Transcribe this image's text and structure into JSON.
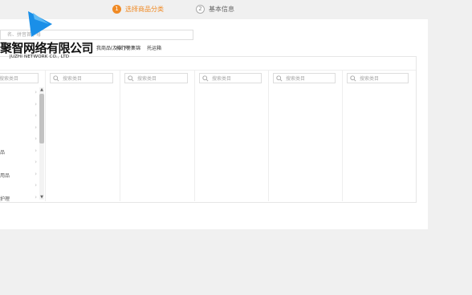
{
  "steps": [
    {
      "num": "1",
      "label": "选择商品分类"
    },
    {
      "num": "2",
      "label": "基本信息"
    }
  ],
  "top_search": {
    "placeholder": "名、拼音首字母"
  },
  "quick_links": [
    "我商品(及以下)",
    "排行榜集锦",
    "托运箱"
  ],
  "columns": [
    {
      "search_placeholder": "搜索类目",
      "items": [
        "",
        "",
        "",
        "",
        "",
        "品",
        "",
        "用品",
        "",
        "护理"
      ]
    },
    {
      "search_placeholder": "搜索类目",
      "items": []
    },
    {
      "search_placeholder": "搜索类目",
      "items": []
    },
    {
      "search_placeholder": "搜索类目",
      "items": []
    },
    {
      "search_placeholder": "搜索类目",
      "items": []
    },
    {
      "search_placeholder": "搜索类目",
      "items": []
    }
  ],
  "watermark": {
    "name_cn": "聚智网络有限公司",
    "name_en": "JUZHI NETWORK CO., LTD",
    "colors": {
      "primary": "#1a8fe8",
      "secondary": "#5dbaf5"
    }
  },
  "theme": {
    "accent": "#f08a24"
  }
}
